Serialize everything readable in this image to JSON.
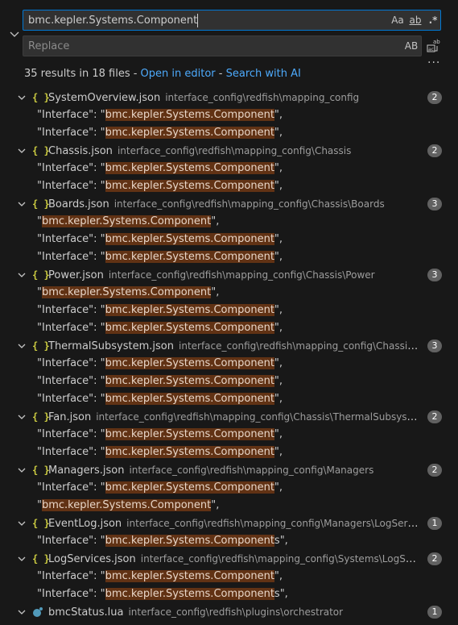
{
  "search": {
    "query": "bmc.kepler.Systems.Component",
    "options": {
      "match_case": "Aa",
      "whole_word": "ab",
      "regex": ".*"
    }
  },
  "replace": {
    "placeholder": "Replace",
    "preserve_case": "AB"
  },
  "summary": {
    "count_text": "35 results in 18 files - ",
    "open_in_editor": "Open in editor",
    "sep": " - ",
    "search_with_ai": "Search with AI"
  },
  "files": [
    {
      "name": "SystemOverview.json",
      "path": "interface_config\\redfish\\mapping_config",
      "count": "2",
      "matches": [
        {
          "pre": "\"Interface\": \"",
          "hl": "bmc.kepler.Systems.Component",
          "post": "\","
        },
        {
          "pre": "\"Interface\": \"",
          "hl": "bmc.kepler.Systems.Component",
          "post": "\","
        }
      ]
    },
    {
      "name": "Chassis.json",
      "path": "interface_config\\redfish\\mapping_config\\Chassis",
      "count": "2",
      "matches": [
        {
          "pre": "\"Interface\": \"",
          "hl": "bmc.kepler.Systems.Component",
          "post": "\","
        },
        {
          "pre": "\"Interface\": \"",
          "hl": "bmc.kepler.Systems.Component",
          "post": "\","
        }
      ]
    },
    {
      "name": "Boards.json",
      "path": "interface_config\\redfish\\mapping_config\\Chassis\\Boards",
      "count": "3",
      "matches": [
        {
          "pre": "\"",
          "hl": "bmc.kepler.Systems.Component",
          "post": "\","
        },
        {
          "pre": "\"Interface\": \"",
          "hl": "bmc.kepler.Systems.Component",
          "post": "\","
        },
        {
          "pre": "\"Interface\": \"",
          "hl": "bmc.kepler.Systems.Component",
          "post": "\","
        }
      ]
    },
    {
      "name": "Power.json",
      "path": "interface_config\\redfish\\mapping_config\\Chassis\\Power",
      "count": "3",
      "matches": [
        {
          "pre": "\"",
          "hl": "bmc.kepler.Systems.Component",
          "post": "\","
        },
        {
          "pre": "\"Interface\": \"",
          "hl": "bmc.kepler.Systems.Component",
          "post": "\","
        },
        {
          "pre": "\"Interface\": \"",
          "hl": "bmc.kepler.Systems.Component",
          "post": "\","
        }
      ]
    },
    {
      "name": "ThermalSubsystem.json",
      "path": "interface_config\\redfish\\mapping_config\\Chassis\\ThermalSub...",
      "count": "3",
      "matches": [
        {
          "pre": "\"Interface\": \"",
          "hl": "bmc.kepler.Systems.Component",
          "post": "\","
        },
        {
          "pre": "\"Interface\": \"",
          "hl": "bmc.kepler.Systems.Component",
          "post": "\","
        },
        {
          "pre": "\"Interface\": \"",
          "hl": "bmc.kepler.Systems.Component",
          "post": "\","
        }
      ]
    },
    {
      "name": "Fan.json",
      "path": "interface_config\\redfish\\mapping_config\\Chassis\\ThermalSubsystem\\Fans\\Fan",
      "count": "2",
      "matches": [
        {
          "pre": "\"Interface\": \"",
          "hl": "bmc.kepler.Systems.Component",
          "post": "\","
        },
        {
          "pre": "\"Interface\": \"",
          "hl": "bmc.kepler.Systems.Component",
          "post": "\","
        }
      ]
    },
    {
      "name": "Managers.json",
      "path": "interface_config\\redfish\\mapping_config\\Managers",
      "count": "2",
      "matches": [
        {
          "pre": "\"Interface\": \"",
          "hl": "bmc.kepler.Systems.Component",
          "post": "\","
        },
        {
          "pre": "\"",
          "hl": "bmc.kepler.Systems.Component",
          "post": "\","
        }
      ]
    },
    {
      "name": "EventLog.json",
      "path": "interface_config\\redfish\\mapping_config\\Managers\\LogServices\\EventLog",
      "count": "1",
      "matches": [
        {
          "pre": "\"Interface\": \"",
          "hl": "bmc.kepler.Systems.Component",
          "post": "s\","
        }
      ]
    },
    {
      "name": "LogServices.json",
      "path": "interface_config\\redfish\\mapping_config\\Systems\\LogServices",
      "count": "2",
      "matches": [
        {
          "pre": "\"Interface\": \"",
          "hl": "bmc.kepler.Systems.Component",
          "post": "\","
        },
        {
          "pre": "\"Interface\": \"",
          "hl": "bmc.kepler.Systems.Component",
          "post": "s\","
        }
      ]
    },
    {
      "name": "bmcStatus.lua",
      "path": "interface_config\\redfish\\plugins\\orchestrator",
      "count": "1",
      "icon": "lua-icon",
      "matches": []
    }
  ],
  "colors": {
    "accent": "#0078d4",
    "highlight": "#613214",
    "link": "#4daafc",
    "json_icon": "#cbcb41"
  }
}
